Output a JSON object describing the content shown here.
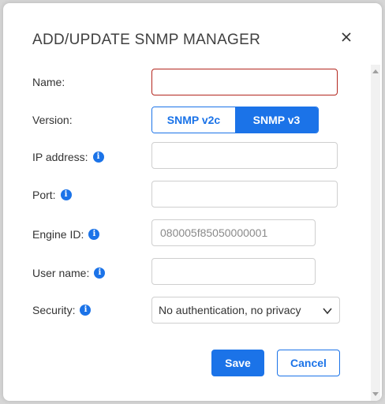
{
  "dialog": {
    "title": "ADD/UPDATE SNMP MANAGER"
  },
  "form": {
    "name": {
      "label": "Name:",
      "value": ""
    },
    "version": {
      "label": "Version:",
      "options": [
        "SNMP v2c",
        "SNMP v3"
      ],
      "selected": "SNMP v3"
    },
    "ip_address": {
      "label": "IP address:",
      "value": ""
    },
    "port": {
      "label": "Port:",
      "value": ""
    },
    "engine_id": {
      "label": "Engine ID:",
      "placeholder": "080005f85050000001",
      "value": ""
    },
    "user_name": {
      "label": "User name:",
      "value": ""
    },
    "security": {
      "label": "Security:",
      "selected": "No authentication, no privacy"
    }
  },
  "actions": {
    "save_label": "Save",
    "cancel_label": "Cancel"
  },
  "icons": {
    "info": "info-icon",
    "close": "close-icon",
    "dropdown": "chevron-down-icon"
  },
  "colors": {
    "accent": "#1b73e8",
    "error_border": "#b3261e"
  }
}
